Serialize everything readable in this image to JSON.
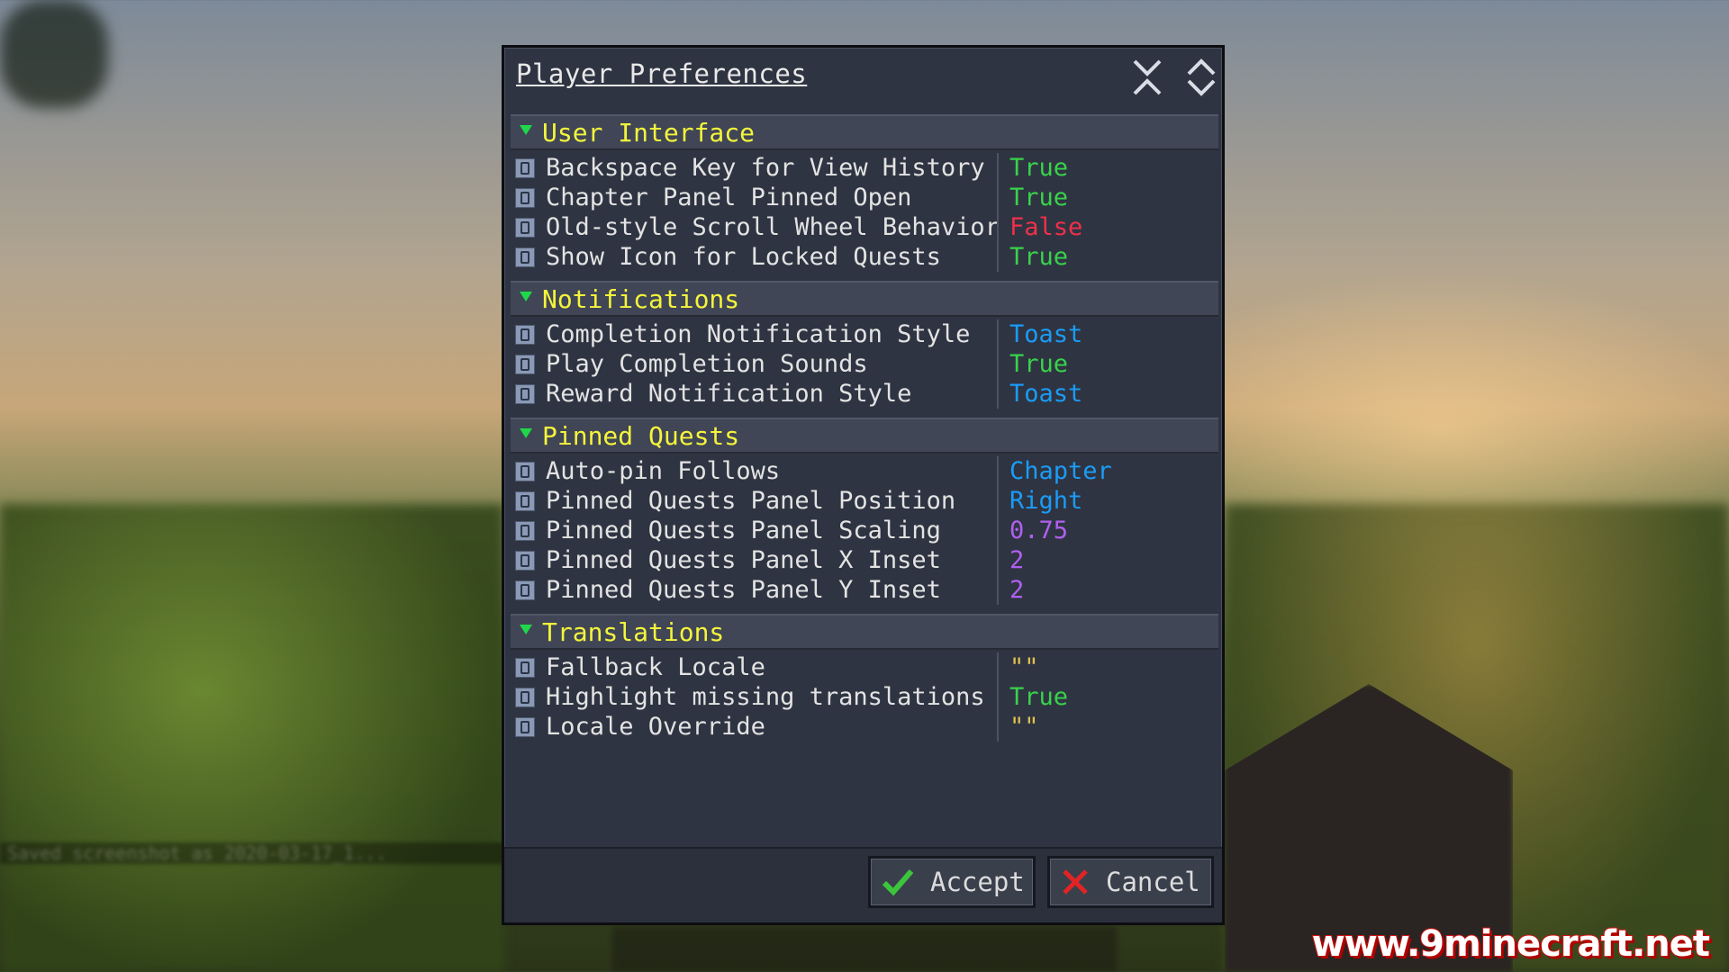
{
  "dialog": {
    "title": "Player Preferences",
    "collapse_icon": "collapse-all-icon",
    "expand_icon": "expand-all-icon"
  },
  "sections": [
    {
      "title": "User Interface",
      "rows": [
        {
          "label": "Backspace Key for View History",
          "value": "True",
          "type": "true"
        },
        {
          "label": "Chapter Panel Pinned Open",
          "value": "True",
          "type": "true"
        },
        {
          "label": "Old-style Scroll Wheel Behavior",
          "value": "False",
          "type": "false"
        },
        {
          "label": "Show Icon for Locked Quests",
          "value": "True",
          "type": "true"
        }
      ]
    },
    {
      "title": "Notifications",
      "rows": [
        {
          "label": "Completion Notification Style",
          "value": "Toast",
          "type": "enum"
        },
        {
          "label": "Play Completion Sounds",
          "value": "True",
          "type": "true"
        },
        {
          "label": "Reward Notification Style",
          "value": "Toast",
          "type": "enum"
        }
      ]
    },
    {
      "title": "Pinned Quests",
      "rows": [
        {
          "label": "Auto-pin Follows",
          "value": "Chapter",
          "type": "enum"
        },
        {
          "label": "Pinned Quests Panel Position",
          "value": "Right",
          "type": "enum"
        },
        {
          "label": "Pinned Quests Panel Scaling",
          "value": "0.75",
          "type": "num"
        },
        {
          "label": "Pinned Quests Panel X Inset",
          "value": "2",
          "type": "num"
        },
        {
          "label": "Pinned Quests Panel Y Inset",
          "value": "2",
          "type": "num"
        }
      ]
    },
    {
      "title": "Translations",
      "rows": [
        {
          "label": "Fallback Locale",
          "value": "\"\"",
          "type": "str"
        },
        {
          "label": "Highlight missing translations",
          "value": "True",
          "type": "true"
        },
        {
          "label": "Locale Override",
          "value": "\"\"",
          "type": "str"
        }
      ]
    }
  ],
  "footer": {
    "accept_label": "Accept",
    "cancel_label": "Cancel"
  },
  "background": {
    "chat_text": "Saved screenshot as 2020-03-17_1..."
  },
  "watermark": "www.9minecraft.net",
  "colors": {
    "true": "#38d24b",
    "false": "#f0304a",
    "enum": "#1a9cf6",
    "num": "#b060f0",
    "section_title": "#f4f43c"
  }
}
